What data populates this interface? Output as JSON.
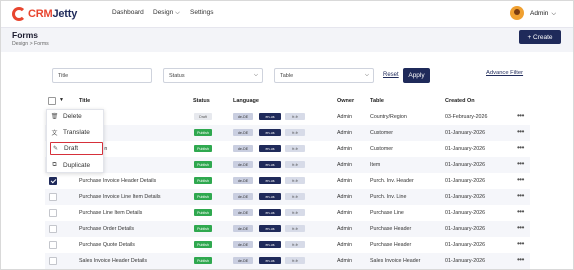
{
  "brand": {
    "name_a": "CRM",
    "name_b": "Jetty",
    "accent": "#e8452f",
    "primary": "#1f2a5a"
  },
  "nav": {
    "dashboard": "Dashboard",
    "design": "Design",
    "settings": "Settings"
  },
  "user": {
    "name": "Admin"
  },
  "page": {
    "title": "Forms",
    "breadcrumb": "Design  >  Forms",
    "create_label": "+ Create"
  },
  "filters": {
    "title_placeholder": "Title",
    "status_label": "Status",
    "table_label": "Table",
    "reset_label": "Reset",
    "apply_label": "Apply",
    "advance_label": "Advance Filter"
  },
  "table": {
    "headers": {
      "title": "Title",
      "status": "Status",
      "language": "Language",
      "owner": "Owner",
      "table": "Table",
      "created_on": "Created On"
    },
    "lang_codes": [
      "de-DE",
      "en-us",
      "fr-fr"
    ],
    "rows": [
      {
        "title": "ntry",
        "status": "Draft",
        "owner": "Admin",
        "table": "Country/Region",
        "created": "03-February-2026",
        "checked": false
      },
      {
        "title": "r Profile",
        "status": "Publish",
        "owner": "Admin",
        "table": "Customer",
        "created": "01-January-2026",
        "checked": false
      },
      {
        "title": "Registration",
        "status": "Publish",
        "owner": "Admin",
        "table": "Customer",
        "created": "01-January-2026",
        "checked": false
      },
      {
        "title": "ls",
        "status": "Publish",
        "owner": "Admin",
        "table": "Item",
        "created": "01-January-2026",
        "checked": false
      },
      {
        "title": "Purchase Invoice Header Details",
        "status": "Publish",
        "owner": "Admin",
        "table": "Purch. Inv. Header",
        "created": "01-January-2026",
        "checked": true
      },
      {
        "title": "Purchase Invoice Line Item Details",
        "status": "Publish",
        "owner": "Admin",
        "table": "Purch. Inv. Line",
        "created": "01-January-2026",
        "checked": false
      },
      {
        "title": "Purchase Line Item Details",
        "status": "Publish",
        "owner": "Admin",
        "table": "Purchase Line",
        "created": "01-January-2026",
        "checked": false
      },
      {
        "title": "Purchase Order Details",
        "status": "Publish",
        "owner": "Admin",
        "table": "Purchase Header",
        "created": "01-January-2026",
        "checked": false
      },
      {
        "title": "Purchase Quote Details",
        "status": "Publish",
        "owner": "Admin",
        "table": "Purchase Header",
        "created": "01-January-2026",
        "checked": false
      },
      {
        "title": "Sales Invoice Header Details",
        "status": "Publish",
        "owner": "Admin",
        "table": "Sales Invoice Header",
        "created": "01-January-2026",
        "checked": false
      }
    ]
  },
  "bulk_menu": {
    "items": [
      {
        "label": "Delete",
        "icon": "trash-icon"
      },
      {
        "label": "Translate",
        "icon": "translate-icon"
      },
      {
        "label": "Draft",
        "icon": "draft-icon"
      },
      {
        "label": "Duplicate",
        "icon": "duplicate-icon"
      }
    ]
  }
}
